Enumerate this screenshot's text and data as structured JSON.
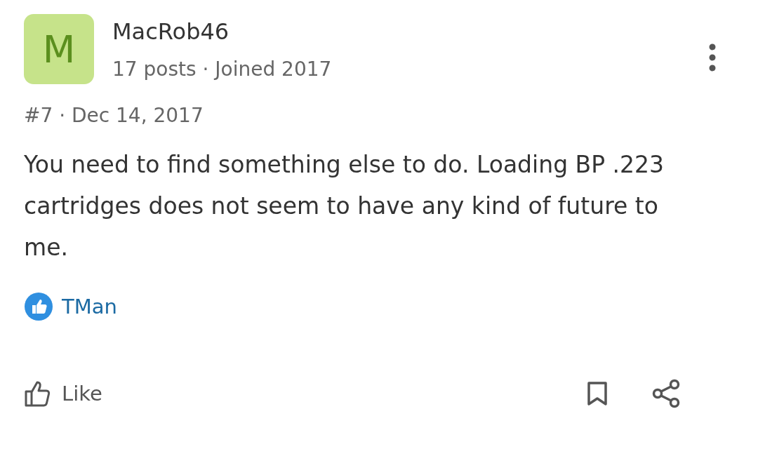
{
  "post": {
    "author": {
      "initial": "M",
      "name": "MacRob46",
      "meta": "17 posts · Joined 2017"
    },
    "number": "#7 · Dec 14, 2017",
    "body": "You need to find something else to do. Loading BP .223 cartridges does not seem to have any kind of future to me.",
    "reactions": [
      {
        "user": "TMan"
      }
    ],
    "actions": {
      "like": "Like"
    }
  }
}
